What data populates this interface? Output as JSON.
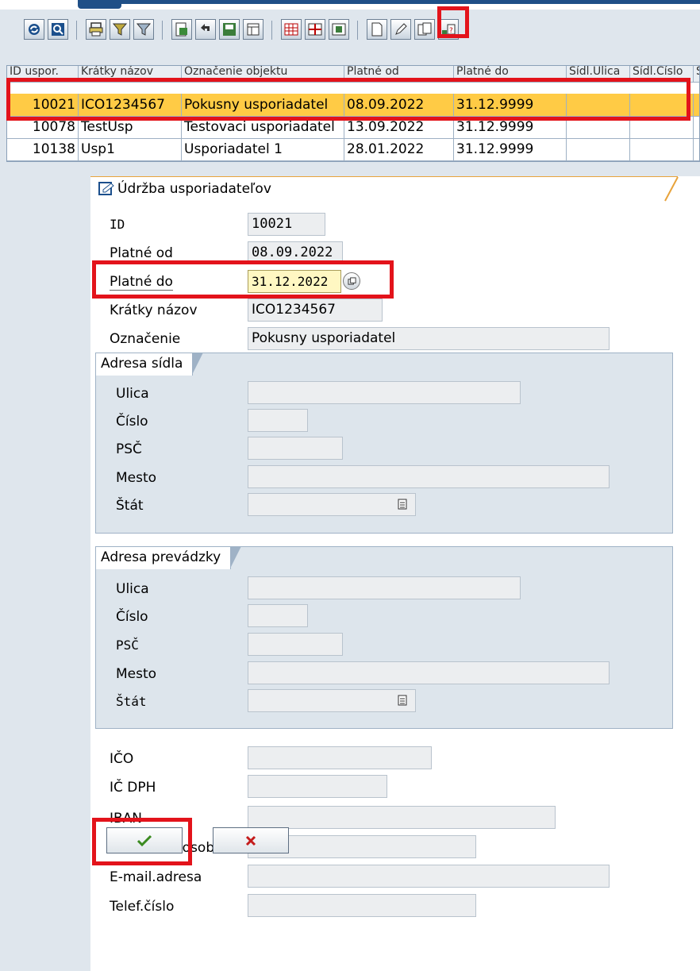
{
  "toolbar": {
    "buttons": [
      {
        "icon": "refresh-icon"
      },
      {
        "icon": "find-icon"
      },
      {
        "icon": "print-icon"
      },
      {
        "icon": "filter-icon"
      },
      {
        "icon": "set-filter-icon"
      },
      {
        "icon": "export-icon"
      },
      {
        "icon": "undo-icon"
      },
      {
        "icon": "save-icon"
      },
      {
        "icon": "layout-icon"
      },
      {
        "icon": "grid-icon"
      },
      {
        "icon": "grid-split-icon"
      },
      {
        "icon": "grid-merge-icon"
      },
      {
        "icon": "new-document-icon"
      },
      {
        "icon": "edit-pencil-icon"
      },
      {
        "icon": "copy-icon"
      },
      {
        "icon": "details-icon"
      }
    ]
  },
  "grid": {
    "columns": [
      "ID uspor.",
      "Krátky názov",
      "Označenie objektu",
      "Platné od",
      "Platné do",
      "Sídl.Ulica",
      "Sídl.Číslo",
      "Sí"
    ],
    "rows": [
      {
        "id": "10021",
        "short": "ICO1234567",
        "name": "Pokusny usporiadatel",
        "from": "08.09.2022",
        "to": "31.12.9999"
      },
      {
        "id": "10078",
        "short": "TestUsp",
        "name": "Testovaci usporiadatel",
        "from": "13.09.2022",
        "to": "31.12.9999"
      },
      {
        "id": "10138",
        "short": "Usp1",
        "name": "Usporiadatel 1",
        "from": "28.01.2022",
        "to": "31.12.9999"
      }
    ]
  },
  "dialog": {
    "title": "Údržba usporiadateľov",
    "fields": {
      "id": {
        "label": "ID",
        "value": "10021"
      },
      "valid_from": {
        "label": "Platné od",
        "value": "08.09.2022"
      },
      "valid_to": {
        "label": "Platné do",
        "value": "31.12.2022"
      },
      "short_name": {
        "label": "Krátky názov",
        "value": "ICO1234567"
      },
      "designation": {
        "label": "Označenie",
        "value": "Pokusny usporiadatel"
      }
    },
    "seat_address": {
      "title": "Adresa sídla",
      "street": "Ulica",
      "number": "Číslo",
      "zip": "PSČ",
      "city": "Mesto",
      "country": "Štát"
    },
    "operation_address": {
      "title": "Adresa prevádzky",
      "street": "Ulica",
      "number": "Číslo",
      "zip": "PSČ",
      "city": "Mesto",
      "country": "Štát"
    },
    "extra": {
      "ico": "IČO",
      "ic_dph": "IČ DPH",
      "iban": "IBAN",
      "contact": "Kontaktná osoba",
      "email": "E-mail.adresa",
      "phone": "Telef.číslo"
    },
    "buttons": {
      "confirm_icon": "checkmark-icon",
      "cancel_icon": "cancel-x-icon"
    }
  },
  "colors": {
    "selection": "#ffcb45",
    "highlight": "#e3131b",
    "input_edit": "#fff7c2"
  }
}
